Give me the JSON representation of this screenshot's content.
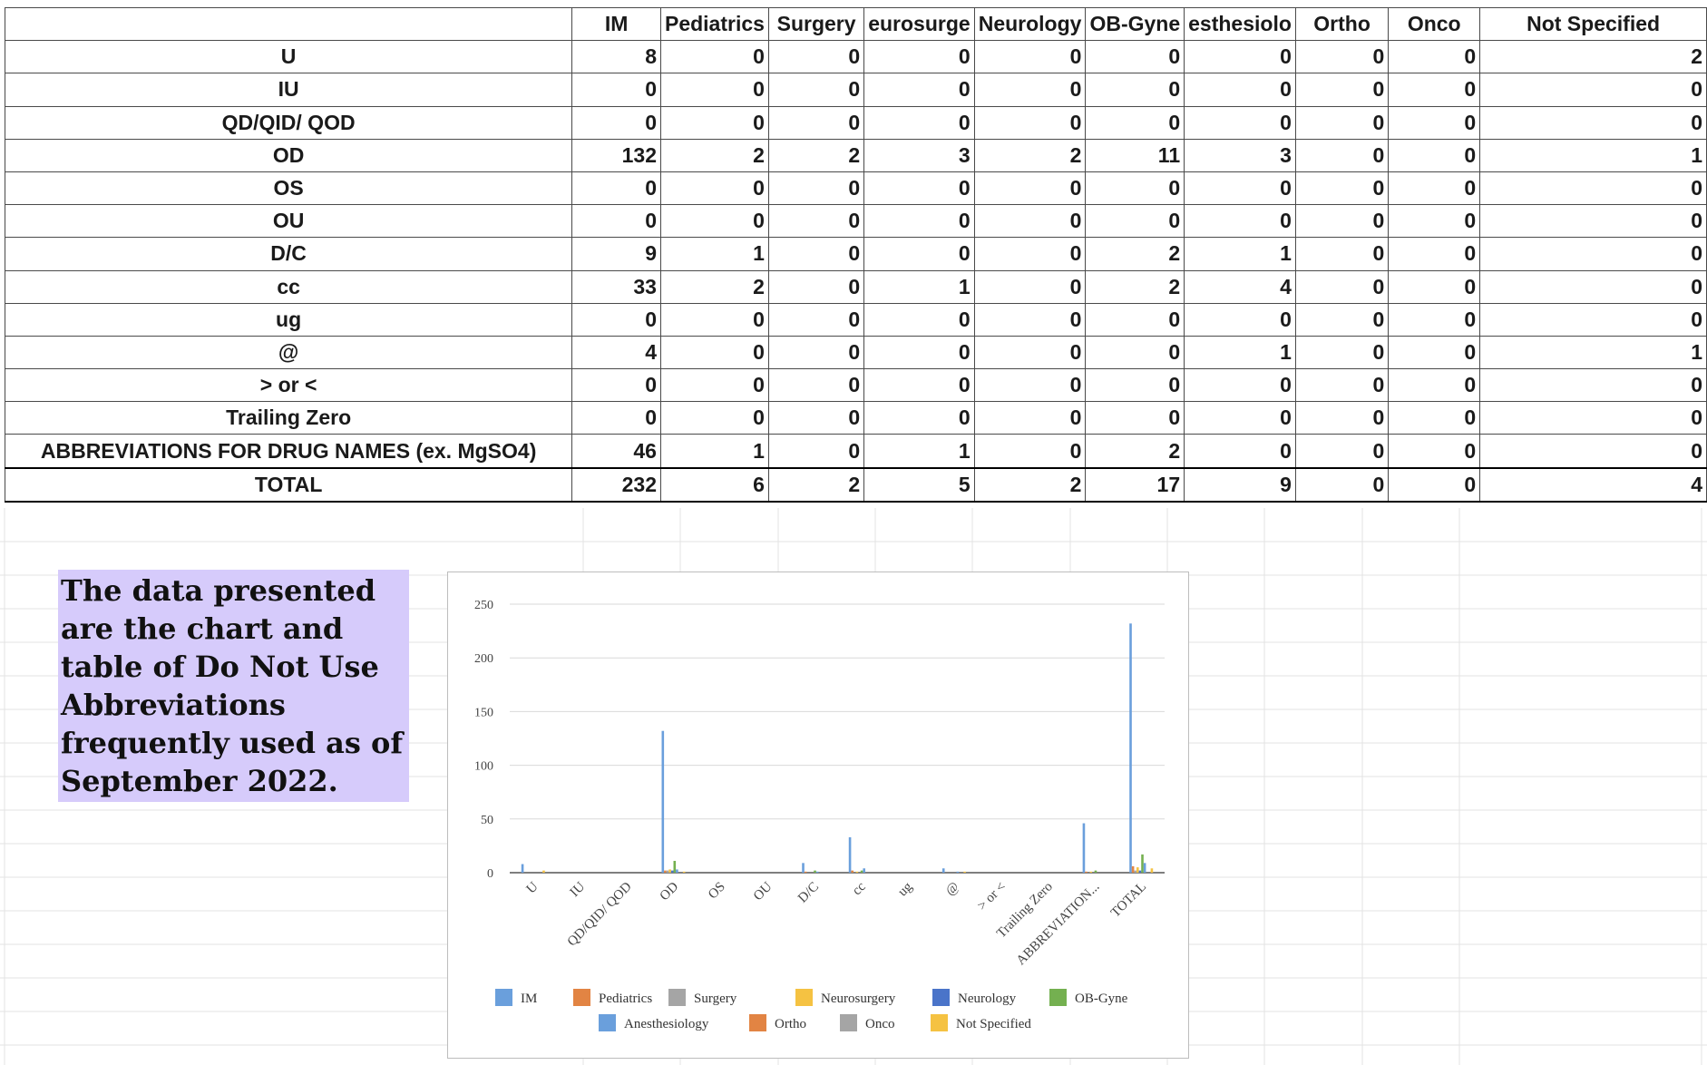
{
  "table": {
    "headers": [
      "",
      "IM",
      "Pediatrics",
      "Surgery",
      "eurosurge",
      "Neurology",
      "OB-Gyne",
      "esthesiolo",
      "Ortho",
      "Onco",
      "Not Specified"
    ],
    "rows": [
      {
        "label": "U",
        "values": [
          8,
          0,
          0,
          0,
          0,
          0,
          0,
          0,
          0,
          2
        ]
      },
      {
        "label": "IU",
        "values": [
          0,
          0,
          0,
          0,
          0,
          0,
          0,
          0,
          0,
          0
        ]
      },
      {
        "label": "QD/QID/ QOD",
        "values": [
          0,
          0,
          0,
          0,
          0,
          0,
          0,
          0,
          0,
          0
        ]
      },
      {
        "label": "OD",
        "values": [
          132,
          2,
          2,
          3,
          2,
          11,
          3,
          0,
          0,
          1
        ]
      },
      {
        "label": "OS",
        "values": [
          0,
          0,
          0,
          0,
          0,
          0,
          0,
          0,
          0,
          0
        ]
      },
      {
        "label": "OU",
        "values": [
          0,
          0,
          0,
          0,
          0,
          0,
          0,
          0,
          0,
          0
        ]
      },
      {
        "label": "D/C",
        "values": [
          9,
          1,
          0,
          0,
          0,
          2,
          1,
          0,
          0,
          0
        ]
      },
      {
        "label": "cc",
        "values": [
          33,
          2,
          0,
          1,
          0,
          2,
          4,
          0,
          0,
          0
        ]
      },
      {
        "label": "ug",
        "values": [
          0,
          0,
          0,
          0,
          0,
          0,
          0,
          0,
          0,
          0
        ]
      },
      {
        "label": "@",
        "values": [
          4,
          0,
          0,
          0,
          0,
          0,
          1,
          0,
          0,
          1
        ]
      },
      {
        "label": "> or <",
        "values": [
          0,
          0,
          0,
          0,
          0,
          0,
          0,
          0,
          0,
          0
        ]
      },
      {
        "label": "Trailing Zero",
        "values": [
          0,
          0,
          0,
          0,
          0,
          0,
          0,
          0,
          0,
          0
        ]
      },
      {
        "label": "ABBREVIATIONS FOR DRUG NAMES (ex. MgSO4)",
        "values": [
          46,
          1,
          0,
          1,
          0,
          2,
          0,
          0,
          0,
          0
        ]
      }
    ],
    "total": {
      "label": "TOTAL",
      "values": [
        232,
        6,
        2,
        5,
        2,
        17,
        9,
        0,
        0,
        4
      ]
    }
  },
  "note": {
    "text": "The data presented are the chart and table of Do Not Use Abbreviations frequently used as of September 2022."
  },
  "chart_data": {
    "type": "bar",
    "categories": [
      "U",
      "IU",
      "QD/QID/ QOD",
      "OD",
      "OS",
      "OU",
      "D/C",
      "cc",
      "ug",
      "@",
      "> or <",
      "Trailing Zero",
      "ABBREVIATION...",
      "TOTAL"
    ],
    "series": [
      {
        "name": "IM",
        "color": "#6a9fdc",
        "values": [
          8,
          0,
          0,
          132,
          0,
          0,
          9,
          33,
          0,
          4,
          0,
          0,
          46,
          232
        ]
      },
      {
        "name": "Pediatrics",
        "color": "#e28443",
        "values": [
          0,
          0,
          0,
          2,
          0,
          0,
          1,
          2,
          0,
          0,
          0,
          0,
          1,
          6
        ]
      },
      {
        "name": "Surgery",
        "color": "#a5a5a5",
        "values": [
          0,
          0,
          0,
          2,
          0,
          0,
          0,
          0,
          0,
          0,
          0,
          0,
          0,
          2
        ]
      },
      {
        "name": "Neurosurgery",
        "color": "#f5c242",
        "values": [
          0,
          0,
          0,
          3,
          0,
          0,
          0,
          1,
          0,
          0,
          0,
          0,
          1,
          5
        ]
      },
      {
        "name": "Neurology",
        "color": "#4a74c9",
        "values": [
          0,
          0,
          0,
          2,
          0,
          0,
          0,
          0,
          0,
          0,
          0,
          0,
          0,
          2
        ]
      },
      {
        "name": "OB-Gyne",
        "color": "#74b050",
        "values": [
          0,
          0,
          0,
          11,
          0,
          0,
          2,
          2,
          0,
          0,
          0,
          0,
          2,
          17
        ]
      },
      {
        "name": "Anesthesiology",
        "color": "#6a9fdc",
        "values": [
          0,
          0,
          0,
          3,
          0,
          0,
          1,
          4,
          0,
          1,
          0,
          0,
          0,
          9
        ]
      },
      {
        "name": "Ortho",
        "color": "#e28443",
        "values": [
          0,
          0,
          0,
          0,
          0,
          0,
          0,
          0,
          0,
          0,
          0,
          0,
          0,
          0
        ]
      },
      {
        "name": "Onco",
        "color": "#a5a5a5",
        "values": [
          0,
          0,
          0,
          0,
          0,
          0,
          0,
          0,
          0,
          0,
          0,
          0,
          0,
          0
        ]
      },
      {
        "name": "Not Specified",
        "color": "#f5c242",
        "values": [
          2,
          0,
          0,
          1,
          0,
          0,
          0,
          0,
          0,
          1,
          0,
          0,
          0,
          4
        ]
      }
    ],
    "ylim": [
      0,
      250
    ],
    "yticks": [
      0,
      50,
      100,
      150,
      200,
      250
    ],
    "grid": true,
    "legend": "bottom",
    "title": "",
    "xlabel": "",
    "ylabel": ""
  }
}
